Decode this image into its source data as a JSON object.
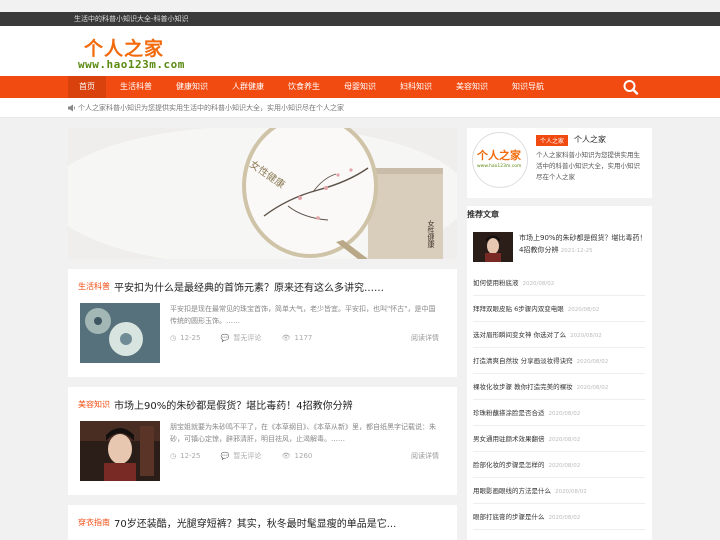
{
  "topbar": {
    "text": "生活中的科普小知识大全-科普小知识"
  },
  "logo": {
    "name": "个人之家",
    "url": "www.hao123m.com"
  },
  "nav": {
    "items": [
      "首页",
      "生活科普",
      "健康知识",
      "人群健康",
      "饮食养生",
      "母婴知识",
      "妇科知识",
      "美容知识",
      "知识导航"
    ]
  },
  "notice": {
    "text": "个人之家科普小知识为您提供实用生活中的科普小知识大全，实用小知识尽在个人之家"
  },
  "banner": {
    "seal_text": "女性健康",
    "box_text": "女性健康"
  },
  "posts": [
    {
      "category": "生活科普",
      "title": "平安扣为什么是最经典的首饰元素？原来还有这么多讲究……",
      "excerpt": "平安扣是现在最常见的珠宝首饰，简单大气，老少皆宜。平安扣，也叫\"怀古\"，是中国传统的圆形玉饰。……",
      "date": "12-25",
      "comments": "暂无评论",
      "views": "1177",
      "more": "阅读详情"
    },
    {
      "category": "美容知识",
      "title": "市场上90%的朱砂都是假货？堪比毒药！4招教你分辨",
      "excerpt": "朋宝姐就要为朱砂鸣不平了，在《本草纲目》、《本草从新》里，都自纸黑字记载说：朱砂，可镇心定惊，辟邪清肝，明目祛风，止渴解毒。……",
      "date": "12-25",
      "comments": "暂无评论",
      "views": "1260",
      "more": "阅读详情"
    },
    {
      "category": "穿衣指南",
      "title": "70岁还装酷，光腿穿短裤？其实，秋冬最时髦显瘦的单品是它..."
    }
  ],
  "author": {
    "avatar_text": "个人之家",
    "avatar_url": "www.hao123m.com",
    "tag": "个人之家",
    "name": "个人之家",
    "desc": "个人之家科普小知识为您提供实用生活中的科普小知识大全，实用小知识尽在个人之家"
  },
  "recommend": {
    "title": "推荐文章",
    "feature": {
      "title": "市场上90%的朱砂都是假货？堪比毒药！4招教你分辨",
      "date": "2021-12-25"
    },
    "items": [
      {
        "title": "如何使用粉底液",
        "date": "2020/08/02"
      },
      {
        "title": "拜拜双眼皮贴 6步骤内双变电眼",
        "date": "2020/08/02"
      },
      {
        "title": "选对眉形瞬间变女神 你选对了么",
        "date": "2020/08/02"
      },
      {
        "title": "打造清爽自然妆 分享画淡妆得诀窍",
        "date": "2020/08/02"
      },
      {
        "title": "裸妆化妆步骤 教你打造完美的裸妆",
        "date": "2020/08/02"
      },
      {
        "title": "珍珠粉蘸搽涂脸是否合适",
        "date": "2020/08/02"
      },
      {
        "title": "男女通用驻颜术效果翻倍",
        "date": "2020/08/02"
      },
      {
        "title": "脸部化妆的步骤是怎样的",
        "date": "2020/08/02"
      },
      {
        "title": "用眼影画眼线的方法是什么",
        "date": "2020/08/02"
      },
      {
        "title": "眼部打底膏的步骤是什么",
        "date": "2020/08/02"
      }
    ]
  },
  "colors": {
    "accent": "#f24b12",
    "topbar": "#3a3a3a",
    "logo_orange": "#f26a0b",
    "logo_green": "#5a8a12"
  }
}
